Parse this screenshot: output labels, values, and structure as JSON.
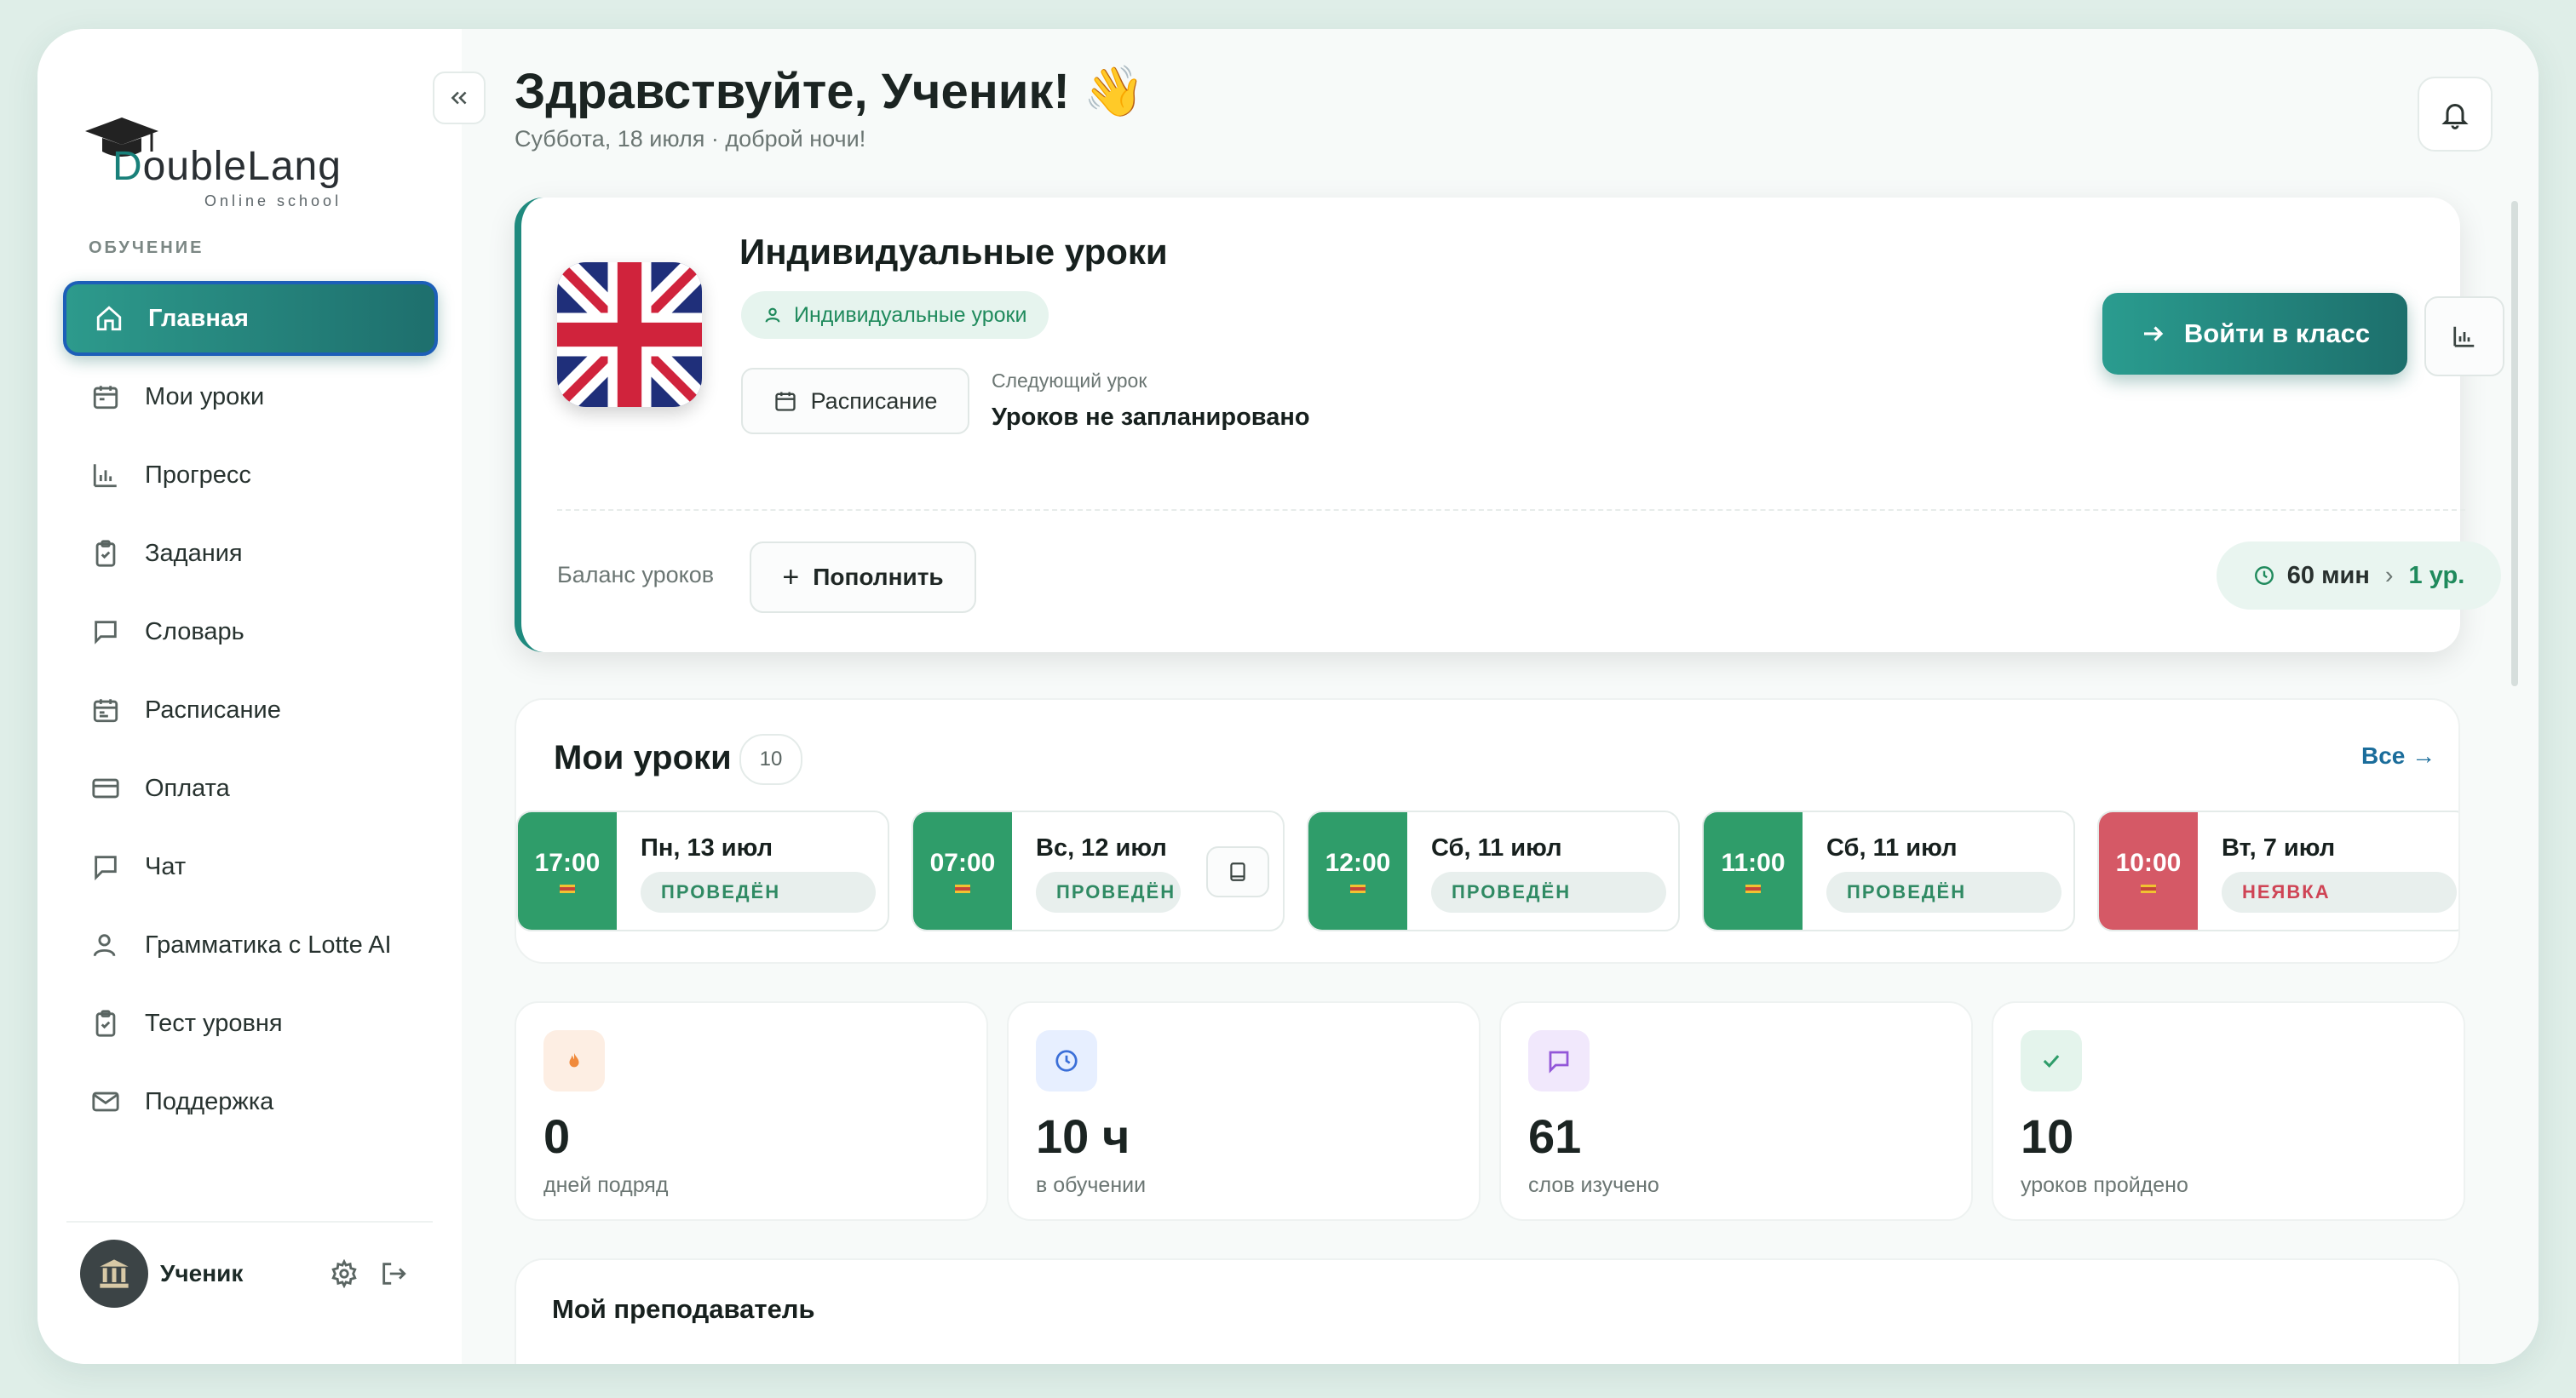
{
  "app": {
    "brand": "DoubleLang",
    "brand_sub": "Online school"
  },
  "sidebar": {
    "section_label": "ОБУЧЕНИЕ",
    "items": [
      {
        "label": "Главная",
        "icon": "home-icon",
        "active": true
      },
      {
        "label": "Мои уроки",
        "icon": "calendar-icon"
      },
      {
        "label": "Прогресс",
        "icon": "bar-chart-icon"
      },
      {
        "label": "Задания",
        "icon": "clipboard-check-icon"
      },
      {
        "label": "Словарь",
        "icon": "message-square-icon"
      },
      {
        "label": "Расписание",
        "icon": "calendar-icon"
      },
      {
        "label": "Оплата",
        "icon": "credit-card-icon"
      },
      {
        "label": "Чат",
        "icon": "chat-bubble-icon"
      },
      {
        "label": "Грамматика с Lotte AI",
        "icon": "user-icon"
      },
      {
        "label": "Тест уровня",
        "icon": "clipboard-check-icon"
      },
      {
        "label": "Поддержка",
        "icon": "mail-icon"
      }
    ],
    "user": {
      "name": "Ученик"
    }
  },
  "header": {
    "greeting": "Здравствуйте, Ученик! 👋",
    "date": "Суббота, 18 июля · доброй ночи!"
  },
  "course": {
    "title": "Индивидуальные уроки",
    "type_chip": "Индивидуальные уроки",
    "schedule_button": "Расписание",
    "next_label": "Следующий урок",
    "next_value": "Уроков не запланировано",
    "enter_button": "Войти в класс",
    "balance_label": "Баланс уроков",
    "topup_button": "Пополнить",
    "duration": "60 мин",
    "balance_count": "1 ур."
  },
  "lessons": {
    "title": "Мои уроки",
    "count": "10",
    "all_link": "Все →",
    "items": [
      {
        "time": "17:00",
        "date": "Пн, 13 июл",
        "status": "ПРОВЕДЁН",
        "state": "done"
      },
      {
        "time": "07:00",
        "date": "Вс, 12 июл",
        "status": "ПРОВЕДЁН",
        "state": "done",
        "has_homework": true
      },
      {
        "time": "12:00",
        "date": "Сб, 11 июл",
        "status": "ПРОВЕДЁН",
        "state": "done"
      },
      {
        "time": "11:00",
        "date": "Сб, 11 июл",
        "status": "ПРОВЕДЁН",
        "state": "done"
      },
      {
        "time": "10:00",
        "date": "Вт, 7 июл",
        "status": "НЕЯВКА",
        "state": "missed"
      }
    ]
  },
  "stats": [
    {
      "value": "0",
      "label": "дней подряд",
      "icon": "flame-icon",
      "color": "#f08a3c",
      "bg": "#fdeee3"
    },
    {
      "value": "10 ч",
      "label": "в обучении",
      "icon": "clock-icon",
      "color": "#3b6fd8",
      "bg": "#e7efff"
    },
    {
      "value": "61",
      "label": "слов изучено",
      "icon": "message-square-icon",
      "color": "#9256d8",
      "bg": "#f1e8fc"
    },
    {
      "value": "10",
      "label": "уроков пройдено",
      "icon": "check-icon",
      "color": "#2f9d6a",
      "bg": "#e4f4ec"
    }
  ],
  "teacher": {
    "title": "Мой преподаватель"
  },
  "colors": {
    "accent": "#1f8a7e",
    "done": "#2f9d6a",
    "missed": "#d55966",
    "link": "#1b6d9b"
  }
}
